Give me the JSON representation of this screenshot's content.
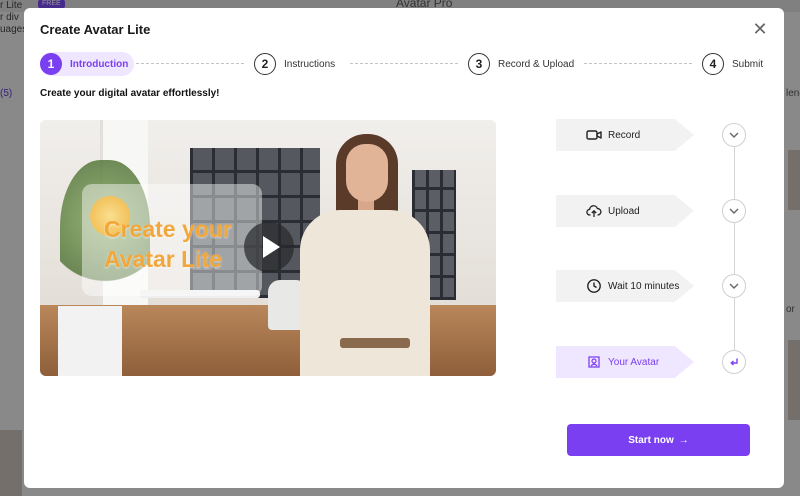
{
  "background": {
    "left_text": "r Lite\nr div\nuages",
    "badge": "FREE",
    "title": "Avatar Pro",
    "left_tab": "(5)",
    "right_tab": "lend",
    "right_text": "or"
  },
  "modal": {
    "title": "Create Avatar Lite",
    "close_icon": "close-icon"
  },
  "steps": [
    {
      "num": "1",
      "label": "Introduction",
      "active": true
    },
    {
      "num": "2",
      "label": "Instructions",
      "active": false
    },
    {
      "num": "3",
      "label": "Record & Upload",
      "active": false
    },
    {
      "num": "4",
      "label": "Submit",
      "active": false
    }
  ],
  "subtitle": "Create your digital avatar effortlessly!",
  "video": {
    "overlay_text": "Create your Avatar Lite",
    "play_icon": "play-icon"
  },
  "flow": [
    {
      "label": "Record",
      "icon": "video-camera-icon",
      "toggle": "chevron-down-icon"
    },
    {
      "label": "Upload",
      "icon": "cloud-upload-icon",
      "toggle": "chevron-down-icon"
    },
    {
      "label": "Wait 10 minutes",
      "icon": "clock-icon",
      "toggle": "chevron-down-icon"
    },
    {
      "label": "Your Avatar",
      "icon": "avatar-badge-icon",
      "toggle": "return-arrow-icon"
    }
  ],
  "start_button": {
    "label": "Start now",
    "icon": "arrow-right-icon"
  },
  "colors": {
    "accent": "#7b3ff2",
    "accent_light": "#efe6ff"
  }
}
